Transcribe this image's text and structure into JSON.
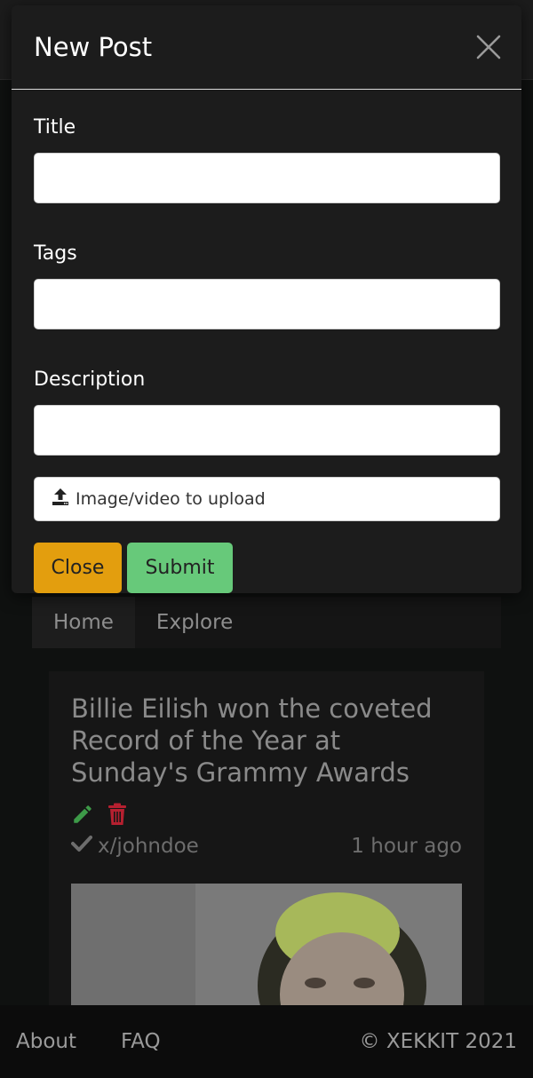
{
  "modal": {
    "title": "New Post",
    "title_label": "Title",
    "title_value": "",
    "tags_label": "Tags",
    "tags_value": "",
    "description_label": "Description",
    "description_value": "",
    "upload_label": "Image/video to upload",
    "close_button": "Close",
    "submit_button": "Submit"
  },
  "nav": {
    "tabs": [
      {
        "label": "Home",
        "active": true
      },
      {
        "label": "Explore",
        "active": false
      }
    ]
  },
  "post": {
    "title": "Billie Eilish won the coveted Record of the Year at Sunday's Grammy Awards",
    "author": "x/johndoe",
    "time": "1 hour ago",
    "icons": [
      "edit-icon",
      "delete-icon",
      "check-icon"
    ]
  },
  "footer": {
    "about": "About",
    "faq": "FAQ",
    "copyright": "© XEKKIT 2021"
  },
  "colors": {
    "close_button": "#e39e0e",
    "submit_button": "#67c97a",
    "edit_icon": "#3d9a48",
    "delete_icon": "#b62030"
  }
}
